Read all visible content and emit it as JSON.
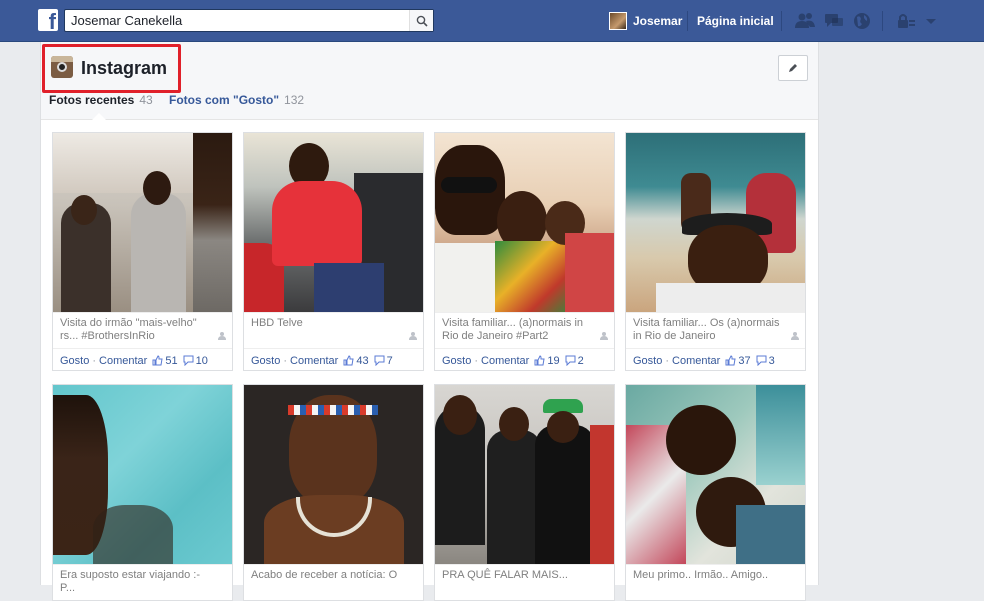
{
  "topbar": {
    "search_value": "Josemar Canekella",
    "user_name": "Josemar",
    "home_label": "Página inicial",
    "icons": [
      "friends-icon",
      "messages-icon",
      "notifications-globe-icon",
      "privacy-lock-icon",
      "account-dropdown-icon"
    ]
  },
  "album": {
    "title": "Instagram",
    "tabs": [
      {
        "label": "Fotos recentes",
        "count": "43"
      },
      {
        "label": "Fotos com \"Gosto\"",
        "count": "132"
      }
    ]
  },
  "photos": [
    {
      "caption": "Visita do irmão \"mais-velho\" rs... #BrothersInRio",
      "like_label": "Gosto",
      "comment_label": "Comentar",
      "likes": "51",
      "comments": "10"
    },
    {
      "caption": "HBD Telve",
      "like_label": "Gosto",
      "comment_label": "Comentar",
      "likes": "43",
      "comments": "7"
    },
    {
      "caption": "Visita familiar... (a)normais in Rio de Janeiro #Part2",
      "like_label": "Gosto",
      "comment_label": "Comentar",
      "likes": "19",
      "comments": "2"
    },
    {
      "caption": "Visita familiar... Os (a)normais in Rio de Janeiro",
      "like_label": "Gosto",
      "comment_label": "Comentar",
      "likes": "37",
      "comments": "3"
    },
    {
      "caption": "Era suposto estar viajando :-P..."
    },
    {
      "caption": "Acabo de receber a notícia: O"
    },
    {
      "caption": "PRA QUÊ FALAR MAIS..."
    },
    {
      "caption": "Meu primo.. Irmão.. Amigo.."
    }
  ],
  "colors": {
    "facebook_blue": "#3b5998",
    "link_blue": "#365899",
    "highlight_red": "#e0202a"
  }
}
